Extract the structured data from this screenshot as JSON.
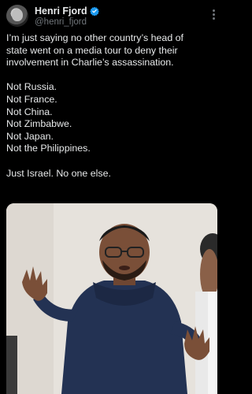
{
  "author": {
    "name": "Henri Fjord",
    "handle": "@henri_fjord",
    "verified": true,
    "accent_color": "#1d9bf0"
  },
  "tweet": {
    "lines": [
      "I’m just saying no other country’s head of",
      "state went on a media tour to deny their",
      "involvement in Charlie’s assassination.",
      "",
      "Not Russia.",
      "Not France.",
      "Not China.",
      "Not Zimbabwe.",
      "Not Japan.",
      "Not the Philippines.",
      "",
      "Just Israel. No one else."
    ]
  },
  "icons": {
    "more": "more-options-icon",
    "verified": "verified-badge-icon"
  }
}
